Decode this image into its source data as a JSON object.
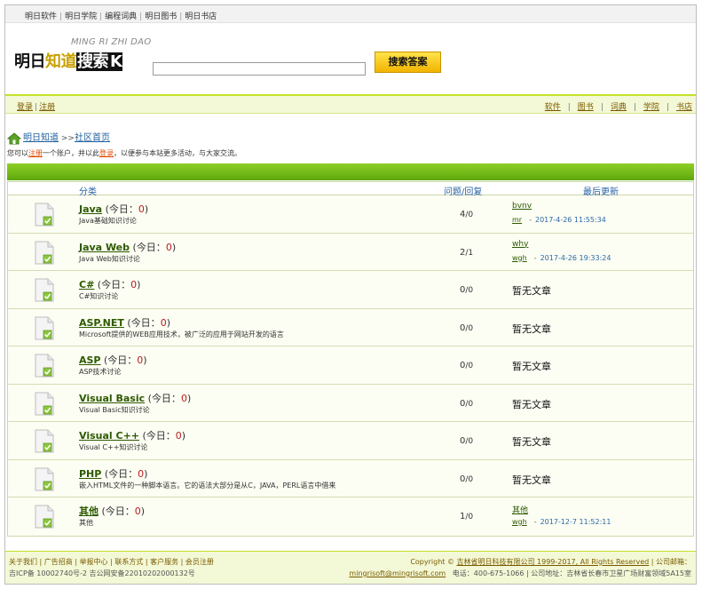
{
  "topbar": {
    "links": [
      "明日软件",
      "明日学院",
      "编程词典",
      "明日图书",
      "明日书店"
    ]
  },
  "logo": {
    "tagline": "MING RI ZHI DAO",
    "text_a": "明日",
    "text_b": "知道",
    "text_c": "搜索",
    "text_d": "K"
  },
  "search": {
    "value": "",
    "button_label": "搜索答案"
  },
  "nav": {
    "login": "登录",
    "register": "注册",
    "right_links": [
      "软件",
      "图书",
      "词典",
      "学院",
      "书店"
    ]
  },
  "breadcrumb": {
    "home": "明日知道",
    "arrow": ">>",
    "current": "社区首页"
  },
  "notice": {
    "prefix": "您可以",
    "register": "注册",
    "middle": "一个账户，并以此",
    "login": "登录",
    "suffix": "，以便参与本站更多活动，与大家交流。"
  },
  "board": {
    "headers": {
      "category": "分类",
      "stats": "问题/回复",
      "latest": "最后更新"
    },
    "today_label": "今日：",
    "empty_label": "暂无文章",
    "rows": [
      {
        "name": "Java",
        "today": "0",
        "desc": "Java基础知识讨论",
        "questions": "4",
        "replies": "0",
        "latest_title": "bvnv",
        "latest_user": "mr",
        "latest_date": "2017-4-26 11:55:34"
      },
      {
        "name": "Java Web",
        "today": "0",
        "desc": "Java Web知识讨论",
        "questions": "2",
        "replies": "1",
        "latest_title": "why",
        "latest_user": "wgh",
        "latest_date": "2017-4-26 19:33:24"
      },
      {
        "name": "C#",
        "today": "0",
        "desc": "C#知识讨论",
        "questions": "0",
        "replies": "0"
      },
      {
        "name": "ASP.NET",
        "today": "0",
        "desc": "Microsoft提供的WEB应用技术，被广泛的应用于网站开发的语言",
        "questions": "0",
        "replies": "0"
      },
      {
        "name": "ASP",
        "today": "0",
        "desc": "ASP技术讨论",
        "questions": "0",
        "replies": "0"
      },
      {
        "name": "Visual Basic",
        "today": "0",
        "desc": "Visual Basic知识讨论",
        "questions": "0",
        "replies": "0"
      },
      {
        "name": "Visual C++",
        "today": "0",
        "desc": "Visual C++知识讨论",
        "questions": "0",
        "replies": "0"
      },
      {
        "name": "PHP",
        "today": "0",
        "desc": "嵌入HTML文件的一种脚本语言。它的语法大部分是从C，JAVA，PERL语言中借来",
        "questions": "0",
        "replies": "0"
      },
      {
        "name": "其他",
        "today": "0",
        "desc": "其他",
        "questions": "1",
        "replies": "0",
        "latest_title": "其他",
        "latest_user": "wgh",
        "latest_date": "2017-12-7 11:52:11"
      }
    ]
  },
  "footer": {
    "links": [
      "关于我们",
      "广告招商",
      "举报中心",
      "联系方式",
      "客户服务",
      "会员注册"
    ],
    "icp": "吉ICP备 10002740号-2 吉公网安备22010202000132号",
    "copyright_prefix": "Copyright © ",
    "company": "吉林省明日科技有限公司 1999-2017, All Rights Reserved",
    "company_email_label": " | 公司邮箱：",
    "email": "mingrisoft@mingrisoft.com",
    "phone": "电话：400-675-1066",
    "address": " | 公司地址：吉林省长春市卫星广场财富领域5A15室"
  }
}
